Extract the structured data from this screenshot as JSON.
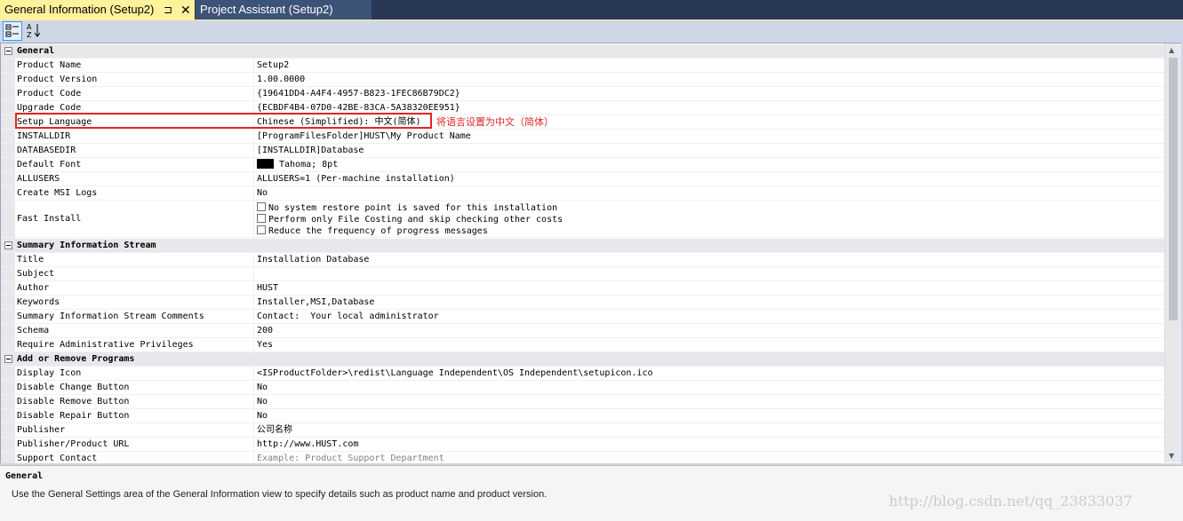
{
  "tabs": [
    {
      "label": "General Information (Setup2)",
      "pin": "⊐",
      "close": "✕"
    },
    {
      "label": "Project Assistant (Setup2)"
    }
  ],
  "toolbar": {
    "categorized_icon": "categorized-icon",
    "alphabetical_icon": "alphabetical-icon",
    "alpha_glyph": "A\nZ↓"
  },
  "grid": {
    "categories": [
      {
        "name": "General"
      },
      {
        "name": "Summary Information Stream"
      },
      {
        "name": "Add or Remove Programs"
      }
    ],
    "general": [
      {
        "name": "Product Name",
        "value": "Setup2"
      },
      {
        "name": "Product Version",
        "value": "1.00.0000"
      },
      {
        "name": "Product Code",
        "value": "{19641DD4-A4F4-4957-B823-1FEC86B79DC2}"
      },
      {
        "name": "Upgrade Code",
        "value": "{ECBDF4B4-07D0-42BE-83CA-5A38320EE951}"
      },
      {
        "name": "Setup Language",
        "value": "Chinese (Simplified): 中文(简体)"
      },
      {
        "name": "INSTALLDIR",
        "value": "[ProgramFilesFolder]HUST\\My Product Name"
      },
      {
        "name": "DATABASEDIR",
        "value": "[INSTALLDIR]Database"
      },
      {
        "name": "Default Font",
        "value": "Tahoma; 8pt"
      },
      {
        "name": "ALLUSERS",
        "value": "ALLUSERS=1 (Per-machine installation)"
      },
      {
        "name": "Create MSI Logs",
        "value": "No"
      }
    ],
    "fast_install": {
      "name": "Fast Install",
      "options": [
        {
          "label": "No system restore point is saved for this installation",
          "checked": false
        },
        {
          "label": "Perform only File Costing and skip checking other costs",
          "checked": false
        },
        {
          "label": "Reduce the frequency of progress messages",
          "checked": false
        }
      ]
    },
    "summary": [
      {
        "name": "Title",
        "value": "Installation Database"
      },
      {
        "name": "Subject",
        "value": ""
      },
      {
        "name": "Author",
        "value": "HUST"
      },
      {
        "name": "Keywords",
        "value": "Installer,MSI,Database"
      },
      {
        "name": "Summary Information Stream Comments",
        "value": "Contact:  Your local administrator"
      },
      {
        "name": "Schema",
        "value": "200"
      },
      {
        "name": "Require Administrative Privileges",
        "value": "Yes"
      }
    ],
    "arp": [
      {
        "name": "Display Icon",
        "value": "<ISProductFolder>\\redist\\Language Independent\\OS Independent\\setupicon.ico"
      },
      {
        "name": "Disable Change Button",
        "value": "No"
      },
      {
        "name": "Disable Remove Button",
        "value": "No"
      },
      {
        "name": "Disable Repair Button",
        "value": "No"
      },
      {
        "name": "Publisher",
        "value": "公司名称"
      },
      {
        "name": "Publisher/Product URL",
        "value": "http://www.HUST.com"
      },
      {
        "name": "Support Contact",
        "value": "Example: Product Support Department"
      }
    ]
  },
  "annotation": "将语言设置为中文（简体）",
  "description": {
    "title": "General",
    "text": "Use the General Settings area of the General Information view to specify details such as product name and product version."
  },
  "watermark": "http://blog.csdn.net/qq_23833037",
  "colors": {
    "active_tab": "#fff29d",
    "tab_bar": "#293955",
    "highlight": "#e32626"
  }
}
